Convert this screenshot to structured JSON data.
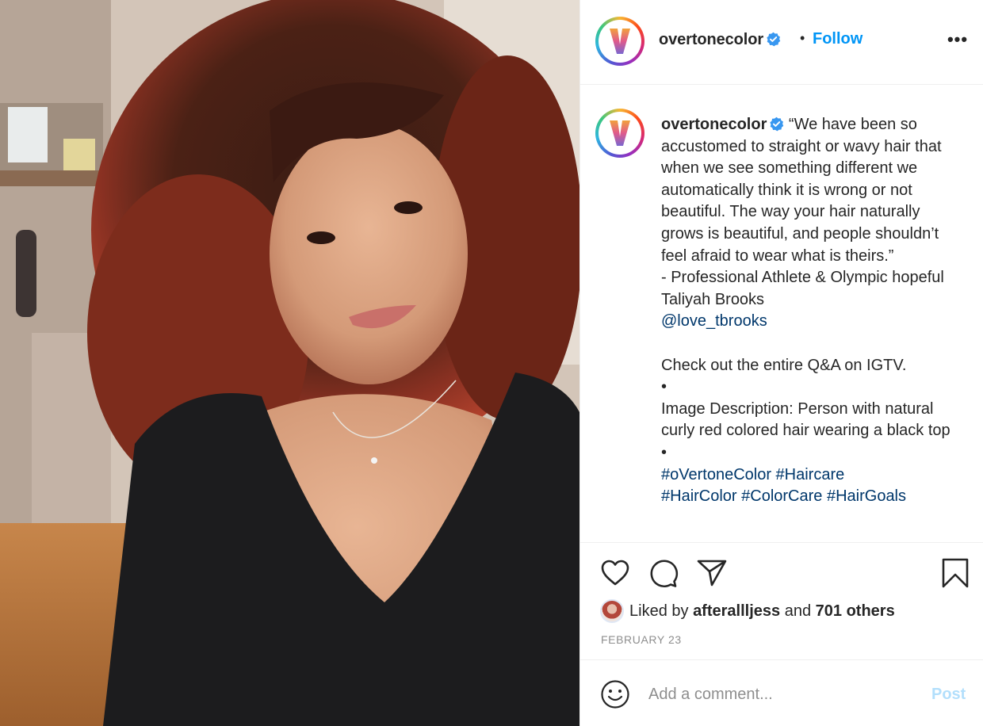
{
  "header": {
    "username": "overtonecolor",
    "separator": "•",
    "follow_label": "Follow",
    "more_label": "•••"
  },
  "caption": {
    "username": "overtonecolor",
    "body": "“We have been so accustomed to straight or wavy hair that when we see something different we automatically think it is wrong or not beautiful. The way your hair naturally grows is beautiful, and people shouldn’t feel afraid to wear what is theirs.”\n- Professional Athlete & Olympic hopeful Taliyah Brooks",
    "mention": "@love_tbrooks",
    "para2": "Check out the entire Q&A on IGTV.\n•\nImage Description: Person with natural curly red colored hair wearing a black top\n•",
    "hashtags_line1": "#oVertoneColor #Haircare",
    "hashtags_line2": "#HairColor #ColorCare #HairGoals"
  },
  "actions": {
    "like_icon": "heart-icon",
    "comment_icon": "comment-icon",
    "share_icon": "paper-plane-icon",
    "save_icon": "bookmark-icon"
  },
  "likes": {
    "prefix": "Liked by ",
    "user": "afterallljess",
    "middle": " and ",
    "count": "701 others"
  },
  "date": "FEBRUARY 23",
  "comment": {
    "placeholder": "Add a comment...",
    "post_label": "Post"
  },
  "colors": {
    "link_blue": "#0095f6",
    "mention_blue": "#00376b",
    "text": "#262626",
    "muted": "#8e8e8e",
    "post_disabled": "#b2dffc"
  }
}
